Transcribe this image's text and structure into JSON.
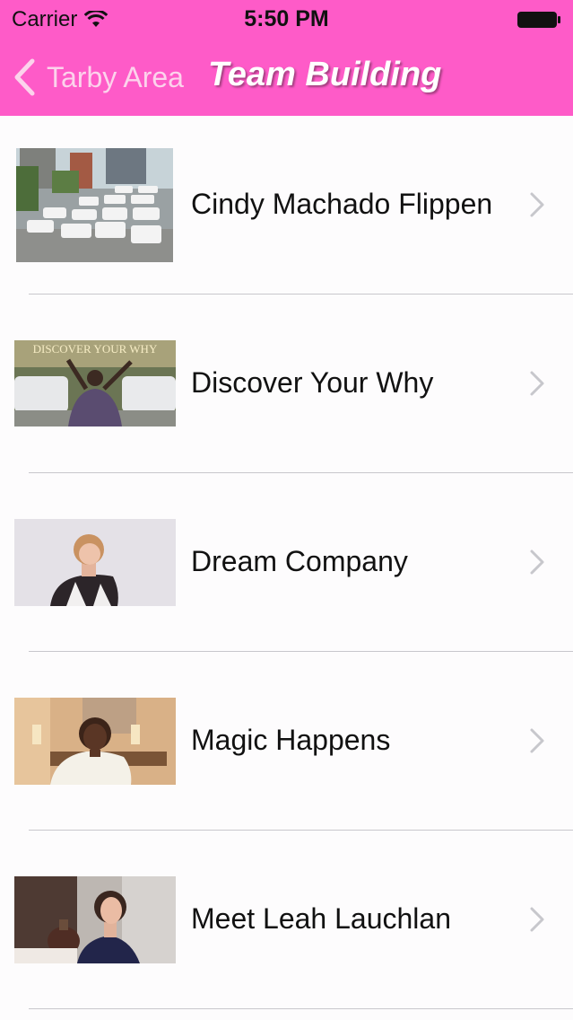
{
  "status_bar": {
    "carrier": "Carrier",
    "time": "5:50 PM",
    "icons": [
      "wifi-icon",
      "battery-icon"
    ]
  },
  "nav": {
    "back_label": "Tarby Area",
    "title": "Team Building"
  },
  "list": {
    "items": [
      {
        "label": "Cindy Machado Flippen",
        "thumbnail": "photo of white limousines in parking lot"
      },
      {
        "label": "Discover Your Why",
        "thumbnail_caption": "DISCOVER YOUR WHY"
      },
      {
        "label": "Dream Company",
        "thumbnail": "video still of presenter"
      },
      {
        "label": "Magic Happens",
        "thumbnail": "video still of presenter"
      },
      {
        "label": "Meet Leah Lauchlan",
        "thumbnail": "video still of presenter"
      }
    ]
  },
  "colors": {
    "header": "#fe5bc8",
    "title": "#ffffff",
    "back_label": "#fcd3ec",
    "separator": "#c8c7cc",
    "chevron": "#c7c7cc"
  }
}
